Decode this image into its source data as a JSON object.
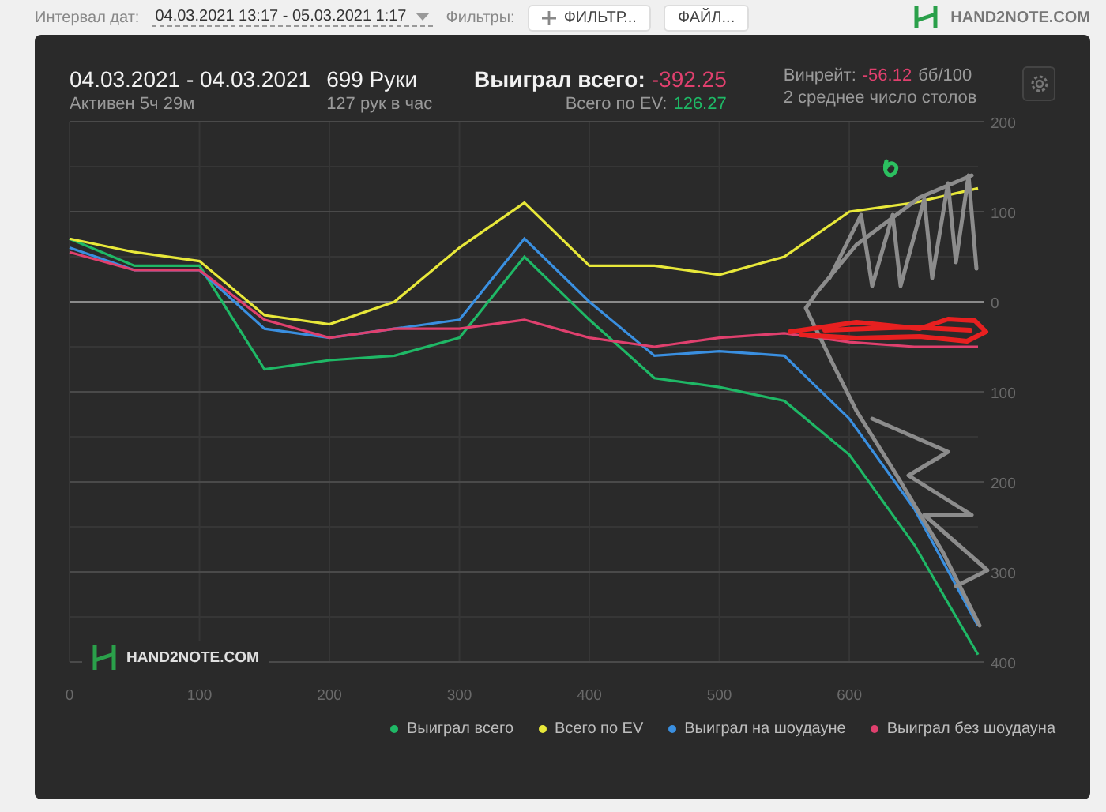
{
  "filter_bar": {
    "date_label": "Интервал дат:",
    "date_value": "04.03.2021 13:17 - 05.03.2021 1:17",
    "filters_label": "Фильтры:",
    "filter_button": "ФИЛЬТР...",
    "file_button": "ФАЙЛ...",
    "logo": "HAND2NOTE.COM"
  },
  "summary": {
    "date_range": "04.03.2021 - 04.03.2021",
    "active_time": "Активен 5ч 29м",
    "hands": "699 Руки",
    "hands_per_hour": "127 рук в час",
    "won_label": "Выиграл всего:",
    "won_value": "-392.25",
    "ev_label": "Всего по EV:",
    "ev_value": "126.27",
    "winrate_label": "Винрейт:",
    "winrate_value": "-56.12",
    "winrate_unit": "бб/100",
    "tables": "2 среднее число столов"
  },
  "chart": {
    "logo": "HAND2NOTE.COM",
    "chart_data": {
      "type": "line",
      "x": [
        0,
        50,
        100,
        150,
        200,
        250,
        300,
        350,
        400,
        450,
        500,
        550,
        600,
        650,
        699
      ],
      "series": [
        {
          "name": "Выиграл всего",
          "color": "#1fb866",
          "values": [
            70,
            40,
            40,
            -75,
            -65,
            -60,
            -40,
            50,
            -20,
            -85,
            -95,
            -110,
            -170,
            -270,
            -392
          ]
        },
        {
          "name": "Всего по EV",
          "color": "#e8e83a",
          "values": [
            70,
            55,
            45,
            -15,
            -25,
            0,
            60,
            110,
            40,
            40,
            30,
            50,
            100,
            110,
            126
          ]
        },
        {
          "name": "Выиграл на шоудауне",
          "color": "#3a8fe0",
          "values": [
            60,
            35,
            35,
            -30,
            -40,
            -30,
            -20,
            70,
            0,
            -60,
            -55,
            -60,
            -130,
            -230,
            -360
          ]
        },
        {
          "name": "Выиграл без шоудауна",
          "color": "#e0406e",
          "values": [
            55,
            35,
            35,
            -20,
            -40,
            -30,
            -30,
            -20,
            -40,
            -50,
            -40,
            -35,
            -45,
            -50,
            -50
          ]
        }
      ],
      "grid": true,
      "xlim": [
        0,
        699
      ],
      "ylim": [
        -400,
        200
      ],
      "xticks": [
        0,
        100,
        200,
        300,
        400,
        500,
        600
      ],
      "yticks": [
        {
          "value": 200,
          "label": "200"
        },
        {
          "value": 100,
          "label": "100"
        },
        {
          "value": 0,
          "label": "0"
        },
        {
          "value": -100,
          "label": "100"
        },
        {
          "value": -200,
          "label": "200"
        },
        {
          "value": -300,
          "label": "300"
        },
        {
          "value": -400,
          "label": "400"
        }
      ]
    }
  }
}
